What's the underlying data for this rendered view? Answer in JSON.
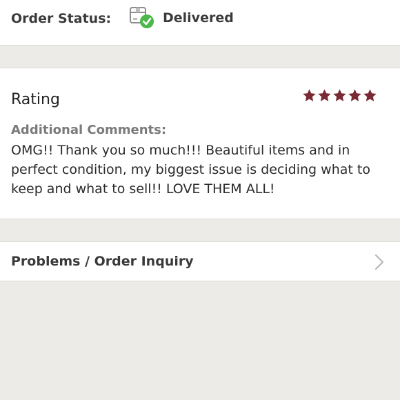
{
  "order_status": {
    "label": "Order Status:",
    "value": "Delivered",
    "icon": "package-delivered-icon",
    "check_color": "#4cb84c"
  },
  "rating": {
    "title": "Rating",
    "stars": 5,
    "max_stars": 5,
    "star_color": "#7a2a33",
    "comments_label": "Additional Comments:",
    "comments_text": "OMG!! Thank you so much!!! Beautiful items and in perfect condition, my biggest issue is deciding what to keep and what to sell!! LOVE THEM ALL!"
  },
  "problems": {
    "label": "Problems / Order Inquiry",
    "icon": "chevron-right-icon"
  }
}
